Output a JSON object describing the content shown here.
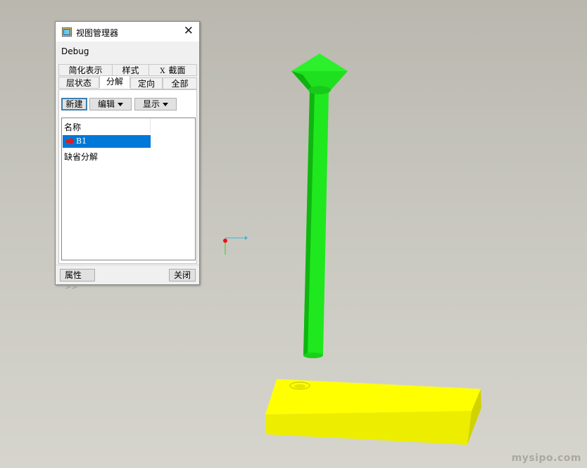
{
  "dialog": {
    "title": "视图管理器",
    "debug_label": "Debug",
    "tabs_row1": [
      "简化表示",
      "样式",
      "截面"
    ],
    "tabs_row2": [
      "层状态",
      "分解",
      "定向",
      "全部"
    ],
    "active_tab": "分解",
    "toolbar": {
      "new_label": "新建",
      "edit_label": "编辑",
      "display_label": "显示"
    },
    "list": {
      "header": "名称",
      "items": [
        {
          "label": "B1",
          "selected": true,
          "icon": "red-arrow-icon"
        },
        {
          "label": "缺省分解",
          "selected": false
        }
      ]
    },
    "footer": {
      "properties_label": "属性",
      "properties_chevron": ">>",
      "close_label": "关闭"
    }
  },
  "viewport": {
    "watermark": "mysipo.com",
    "colors": {
      "pin": "#1fe81f",
      "base_plate": "#ffff00",
      "background": "#c8c7bf"
    }
  }
}
